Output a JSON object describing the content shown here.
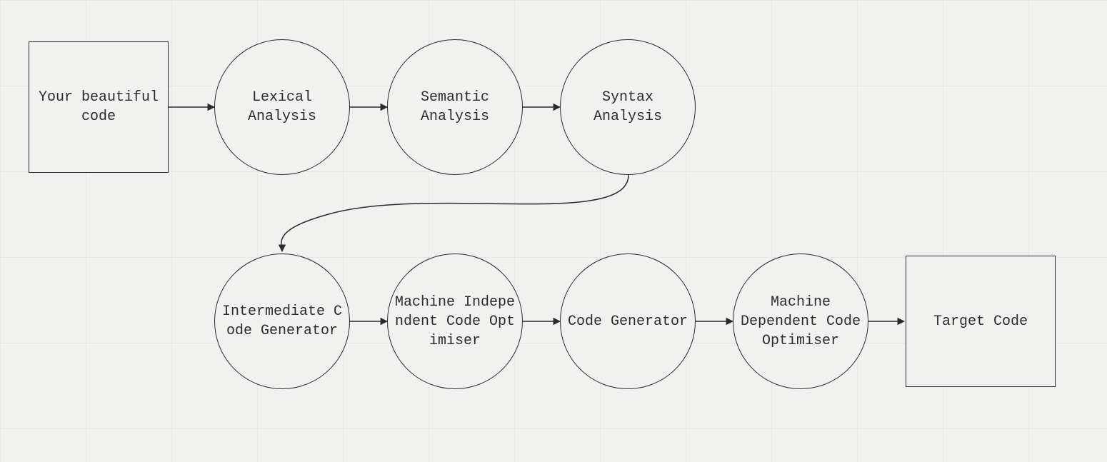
{
  "nodes": {
    "source": {
      "label": "Your beautiful code"
    },
    "lexical": {
      "label": "Lexical Analysis"
    },
    "semantic": {
      "label": "Semantic Analysis"
    },
    "syntax": {
      "label": "Syntax Analysis"
    },
    "intermediate": {
      "label": "Intermediate Code Generator"
    },
    "mi_opt": {
      "label": "Machine Independent Code Optimiser"
    },
    "codegen": {
      "label": "Code Generator"
    },
    "md_opt": {
      "label": "Machine Dependent Code Optimiser"
    },
    "target": {
      "label": "Target Code"
    }
  },
  "edges": [
    [
      "source",
      "lexical"
    ],
    [
      "lexical",
      "semantic"
    ],
    [
      "semantic",
      "syntax"
    ],
    [
      "syntax",
      "intermediate"
    ],
    [
      "intermediate",
      "mi_opt"
    ],
    [
      "mi_opt",
      "codegen"
    ],
    [
      "codegen",
      "md_opt"
    ],
    [
      "md_opt",
      "target"
    ]
  ]
}
